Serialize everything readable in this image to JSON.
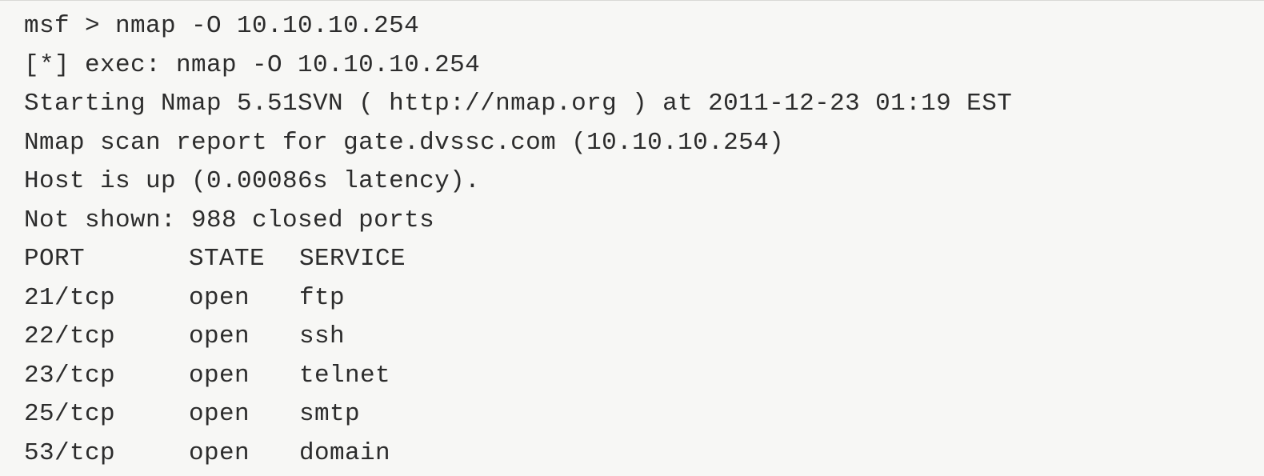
{
  "terminal": {
    "lines": [
      "msf > nmap -O 10.10.10.254",
      "[*] exec: nmap -O 10.10.10.254",
      "Starting Nmap 5.51SVN ( http://nmap.org ) at 2011-12-23 01:19 EST",
      "Nmap scan report for gate.dvssc.com (10.10.10.254)",
      "Host is up (0.00086s latency).",
      "Not shown: 988 closed ports"
    ],
    "table": {
      "headers": [
        "PORT",
        "STATE",
        "SERVICE"
      ],
      "rows": [
        {
          "port": "21/tcp",
          "state": "open",
          "service": "ftp"
        },
        {
          "port": "22/tcp",
          "state": "open",
          "service": "ssh"
        },
        {
          "port": "23/tcp",
          "state": "open",
          "service": "telnet"
        },
        {
          "port": "25/tcp",
          "state": "open",
          "service": "smtp"
        },
        {
          "port": "53/tcp",
          "state": "open",
          "service": "domain"
        }
      ]
    }
  }
}
